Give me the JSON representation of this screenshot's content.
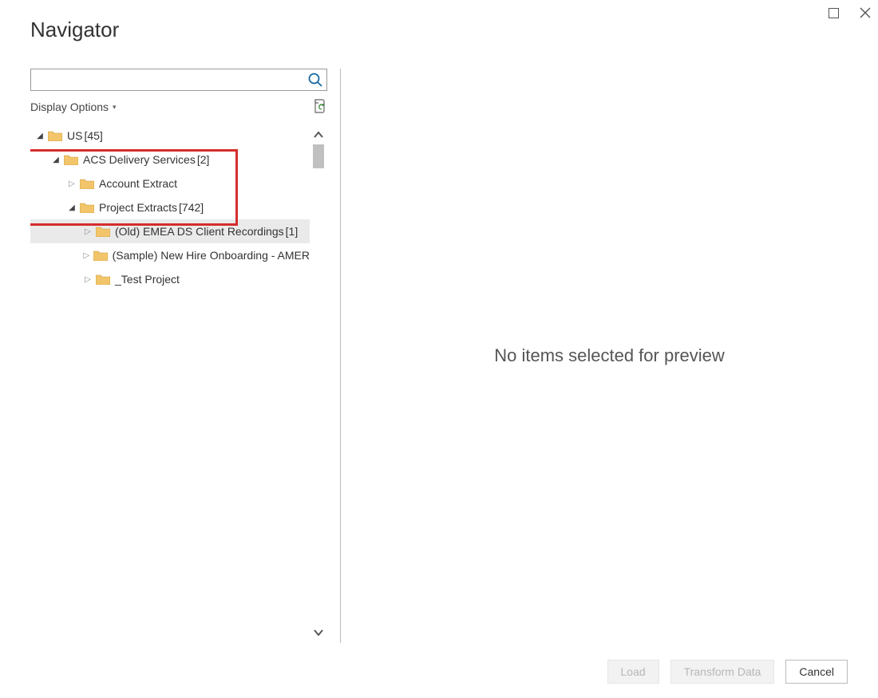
{
  "window": {
    "title": "Navigator"
  },
  "search": {
    "value": "",
    "placeholder": ""
  },
  "options": {
    "display_label": "Display Options"
  },
  "tree": {
    "root": {
      "label": "US",
      "count": "[45]",
      "expanded": true,
      "children": [
        {
          "label": "ACS Delivery Services",
          "count": "[2]",
          "expanded": true,
          "children": [
            {
              "label": "Account Extract",
              "count": "",
              "expanded": false,
              "children": []
            },
            {
              "label": "Project Extracts",
              "count": "[742]",
              "expanded": true,
              "children": [
                {
                  "label": "(Old) EMEA DS Client Recordings",
                  "count": "[1]",
                  "expanded": false,
                  "selected": true,
                  "children": []
                },
                {
                  "label": "(Sample) New Hire Onboarding - AMER",
                  "count": "",
                  "expanded": false,
                  "children": []
                },
                {
                  "label": "_Test Project",
                  "count": "",
                  "expanded": false,
                  "children": []
                }
              ]
            }
          ]
        }
      ]
    }
  },
  "preview": {
    "empty_message": "No items selected for preview"
  },
  "buttons": {
    "load": "Load",
    "transform": "Transform Data",
    "cancel": "Cancel"
  }
}
